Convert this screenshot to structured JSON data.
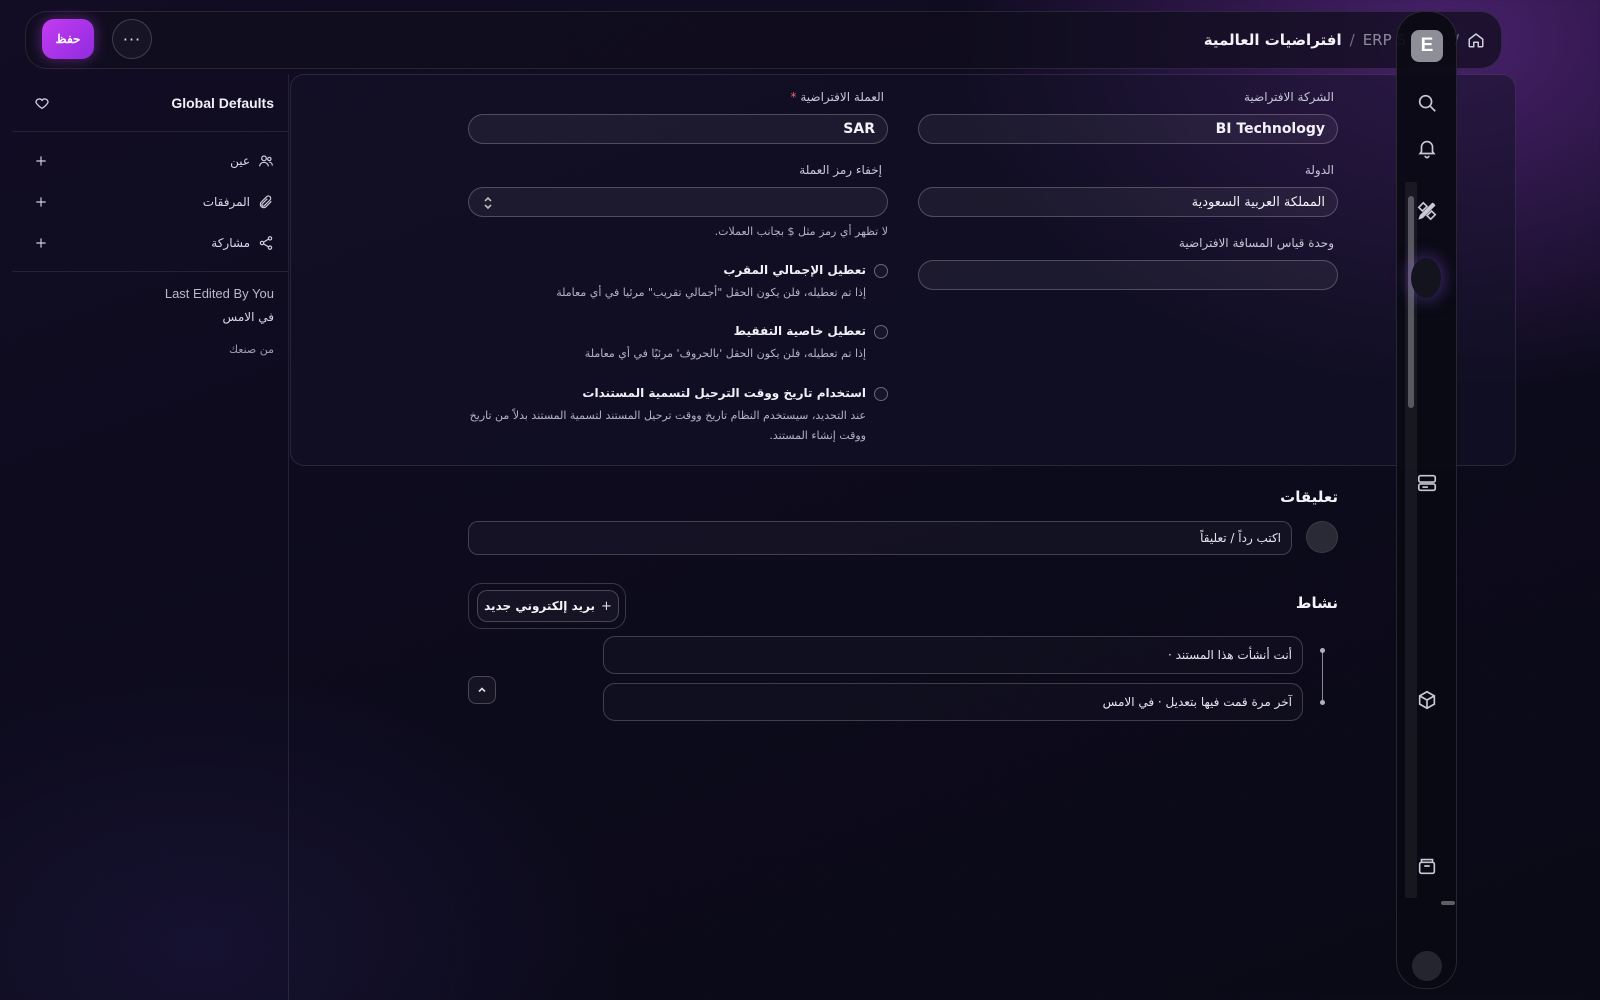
{
  "header": {
    "save_label": "حفظ",
    "more_label": "···",
    "breadcrumb": {
      "app": "ERP S",
      "title": "افتراضيات العالمية"
    }
  },
  "sidebar": {
    "title": "Global Defaults",
    "actions": [
      {
        "label": "عين",
        "icon": "users-icon"
      },
      {
        "label": "المرفقات",
        "icon": "paperclip-icon"
      },
      {
        "label": "مشاركة",
        "icon": "share-icon"
      }
    ],
    "last_edited": "Last Edited By You",
    "edited_when": "في الامس",
    "created_by": "من صنعك"
  },
  "form": {
    "default_company": {
      "label": "الشركة الافتراضية",
      "value": "BI Technology"
    },
    "default_currency": {
      "label": "العملة الافتراضية",
      "required_mark": "*",
      "value": "SAR"
    },
    "country": {
      "label": "الدولة",
      "value": "المملكة العربية السعودية"
    },
    "hide_currency_symbol": {
      "label": "إخفاء رمز العملة",
      "value": "",
      "help": "لا تظهر أي رمز مثل $ بجانب العملات."
    },
    "distance_uom": {
      "label": "وحدة قياس المسافة الافتراضية",
      "value": ""
    },
    "disable_rounded_total": {
      "title": "تعطيل الإجمالي المقرب",
      "description": "إذا تم تعطيله، فلن يكون الحقل \"أجمالي تقريب\" مرئيا في أي معاملة"
    },
    "disable_in_words": {
      "title": "تعطيل خاصية التفقيط",
      "description": "إذا تم تعطيله، فلن يكون الحقل 'بالحروف' مرئيًا في أي معاملة"
    },
    "use_posting_datetime": {
      "title": "استخدام تاريخ ووقت الترحيل لتسمية المستندات",
      "description_line1": "عند التحديد، سيستخدم النظام تاريخ ووقت ترحيل المستند لتسمية المستند بدلاً من تاريخ",
      "description_line2": "ووقت إنشاء المستند."
    }
  },
  "comments": {
    "heading": "تعليقات",
    "placeholder": "اكتب رداً / تعليقاً"
  },
  "activity": {
    "heading": "نشاط",
    "new_email_label": "بريد إلكتروني جديد",
    "new_email_plus": "+",
    "items": [
      "أنت أنشأت هذا المستند ·",
      "آخر مرة قمت فيها بتعديل · في الامس"
    ]
  },
  "right_panel": {
    "logo_letter": "E"
  }
}
